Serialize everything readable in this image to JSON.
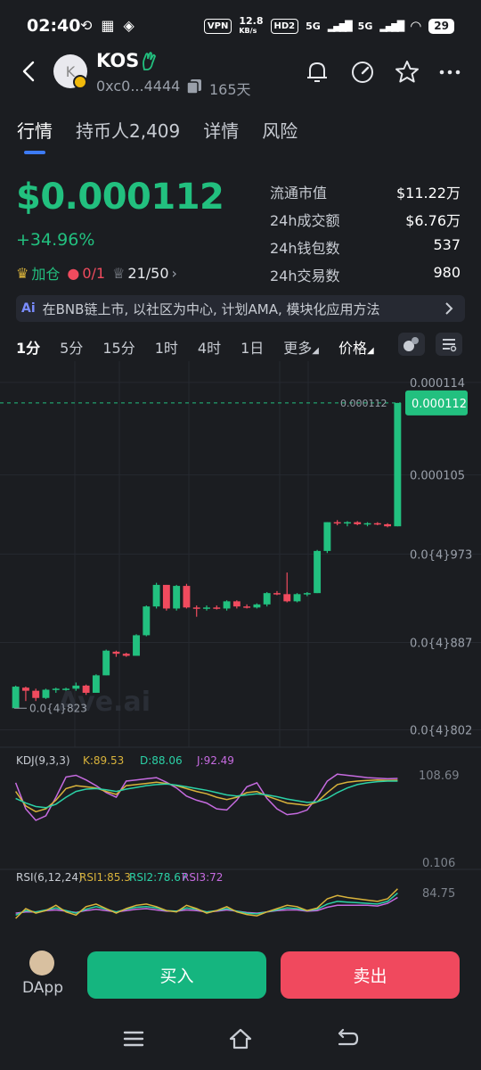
{
  "status": {
    "time": "02:40",
    "vpn": "VPN",
    "net_speed_top": "12.8",
    "net_speed_bottom": "KB/s",
    "hd": "HD2",
    "sig1": "5G",
    "sig2": "5G",
    "battery": "29"
  },
  "header": {
    "token_symbol": "KOS",
    "avatar_letter": "K",
    "address": "0xc0...4444",
    "age": "165天"
  },
  "tabs": [
    {
      "label": "行情"
    },
    {
      "label": "持币人2,409"
    },
    {
      "label": "详情"
    },
    {
      "label": "风险"
    }
  ],
  "price": {
    "value": "$0.000112",
    "change": "+34.96%"
  },
  "chips": {
    "add": "加仓",
    "bag": "0/1",
    "crown": "21/50"
  },
  "stats": [
    {
      "label": "流通市值",
      "value": "$11.22万"
    },
    {
      "label": "24h成交额",
      "value": "$6.76万"
    },
    {
      "label": "24h钱包数",
      "value": "537"
    },
    {
      "label": "24h交易数",
      "value": "980"
    }
  ],
  "ai_banner": {
    "tag": "Ai",
    "text": "在BNB链上市, 以社区为中心, 计划AMA, 模块化应用方法"
  },
  "intervals": {
    "items": [
      "1分",
      "5分",
      "15分",
      "1时",
      "4时",
      "1日"
    ],
    "more": "更多",
    "price": "价格"
  },
  "colors": {
    "up": "#22c07f",
    "down": "#f04b5e",
    "k": "#d9b33b",
    "d": "#2bd1a6",
    "j": "#c66be0",
    "rsi1": "#d9b33b",
    "rsi2": "#2bd1a6",
    "rsi3": "#c66be0"
  },
  "chart_data": {
    "type": "candlestick",
    "ylim": [
      8.02e-05,
      0.000114
    ],
    "y_ticks": [
      "0.000114",
      "0.000105",
      "0.0{4}973",
      "0.0{4}887",
      "0.0{4}802"
    ],
    "y_tick_values": [
      0.000114,
      0.000105,
      9.73e-05,
      8.87e-05,
      8.02e-05
    ],
    "last_price_label": "0.000112",
    "last_price": 0.000112,
    "low_label": "0.0{4}823",
    "low_value": 8.23e-05,
    "watermark": "Ave.ai",
    "candles": [
      {
        "o": 8.23e-05,
        "h": 8.45e-05,
        "l": 8.23e-05,
        "c": 8.44e-05
      },
      {
        "o": 8.43e-05,
        "h": 8.44e-05,
        "l": 8.3e-05,
        "c": 8.4e-05
      },
      {
        "o": 8.4e-05,
        "h": 8.42e-05,
        "l": 8.3e-05,
        "c": 8.33e-05
      },
      {
        "o": 8.33e-05,
        "h": 8.42e-05,
        "l": 8.32e-05,
        "c": 8.41e-05
      },
      {
        "o": 8.41e-05,
        "h": 8.43e-05,
        "l": 8.38e-05,
        "c": 8.42e-05
      },
      {
        "o": 8.42e-05,
        "h": 8.43e-05,
        "l": 8.4e-05,
        "c": 8.42e-05
      },
      {
        "o": 8.42e-05,
        "h": 8.48e-05,
        "l": 8.4e-05,
        "c": 8.45e-05
      },
      {
        "o": 8.45e-05,
        "h": 8.46e-05,
        "l": 8.36e-05,
        "c": 8.38e-05
      },
      {
        "o": 8.38e-05,
        "h": 8.56e-05,
        "l": 8.38e-05,
        "c": 8.55e-05
      },
      {
        "o": 8.55e-05,
        "h": 8.8e-05,
        "l": 8.55e-05,
        "c": 8.79e-05
      },
      {
        "o": 8.78e-05,
        "h": 8.79e-05,
        "l": 8.73e-05,
        "c": 8.76e-05
      },
      {
        "o": 8.76e-05,
        "h": 8.77e-05,
        "l": 8.73e-05,
        "c": 8.74e-05
      },
      {
        "o": 8.74e-05,
        "h": 8.95e-05,
        "l": 8.74e-05,
        "c": 8.94e-05
      },
      {
        "o": 8.94e-05,
        "h": 9.23e-05,
        "l": 8.93e-05,
        "c": 9.22e-05
      },
      {
        "o": 9.22e-05,
        "h": 9.45e-05,
        "l": 9.2e-05,
        "c": 9.43e-05
      },
      {
        "o": 9.43e-05,
        "h": 9.42e-05,
        "l": 9.18e-05,
        "c": 9.2e-05
      },
      {
        "o": 9.2e-05,
        "h": 9.43e-05,
        "l": 9.18e-05,
        "c": 9.42e-05
      },
      {
        "o": 9.42e-05,
        "h": 9.44e-05,
        "l": 9.2e-05,
        "c": 9.21e-05
      },
      {
        "o": 9.21e-05,
        "h": 9.23e-05,
        "l": 9.12e-05,
        "c": 9.2e-05
      },
      {
        "o": 9.2e-05,
        "h": 9.23e-05,
        "l": 9.18e-05,
        "c": 9.21e-05
      },
      {
        "o": 9.21e-05,
        "h": 9.23e-05,
        "l": 9.19e-05,
        "c": 9.2e-05
      },
      {
        "o": 9.2e-05,
        "h": 9.28e-05,
        "l": 9.18e-05,
        "c": 9.27e-05
      },
      {
        "o": 9.27e-05,
        "h": 9.28e-05,
        "l": 9.2e-05,
        "c": 9.22e-05
      },
      {
        "o": 9.22e-05,
        "h": 9.24e-05,
        "l": 9.2e-05,
        "c": 9.21e-05
      },
      {
        "o": 9.21e-05,
        "h": 9.25e-05,
        "l": 9.2e-05,
        "c": 9.24e-05
      },
      {
        "o": 9.24e-05,
        "h": 9.36e-05,
        "l": 9.22e-05,
        "c": 9.35e-05
      },
      {
        "o": 9.35e-05,
        "h": 9.37e-05,
        "l": 9.33e-05,
        "c": 9.34e-05
      },
      {
        "o": 9.34e-05,
        "h": 9.55e-05,
        "l": 9.26e-05,
        "c": 9.27e-05
      },
      {
        "o": 9.27e-05,
        "h": 9.35e-05,
        "l": 9.26e-05,
        "c": 9.34e-05
      },
      {
        "o": 9.34e-05,
        "h": 9.36e-05,
        "l": 9.32e-05,
        "c": 9.35e-05
      },
      {
        "o": 9.35e-05,
        "h": 9.77e-05,
        "l": 9.35e-05,
        "c": 9.76e-05
      },
      {
        "o": 9.76e-05,
        "h": 9.8e-05,
        "l": 9.74e-05,
        "c": 0.0001004
      },
      {
        "o": 0.0001004,
        "h": 0.0001006,
        "l": 0.0001001,
        "c": 0.0001003
      },
      {
        "o": 0.0001003,
        "h": 0.0001005,
        "l": 0.0001,
        "c": 0.0001004
      },
      {
        "o": 0.0001004,
        "h": 0.0001005,
        "l": 0.0001001,
        "c": 0.0001002
      },
      {
        "o": 0.0001002,
        "h": 0.0001004,
        "l": 0.0001,
        "c": 0.0001003
      },
      {
        "o": 0.0001003,
        "h": 0.0001004,
        "l": 0.0001001,
        "c": 0.0001002
      },
      {
        "o": 0.0001002,
        "h": 0.0001003,
        "l": 9.99e-05,
        "c": 0.0001
      },
      {
        "o": 0.0001,
        "h": 0.000112,
        "l": 0.0001,
        "c": 0.000112
      }
    ]
  },
  "kdj": {
    "label": "KDJ(9,3,3)",
    "k_label": "K:89.53",
    "d_label": "D:88.06",
    "j_label": "J:92.49",
    "top": "108.69",
    "bottom": "0.106",
    "k": [
      70,
      45,
      35,
      40,
      55,
      75,
      80,
      78,
      76,
      70,
      65,
      80,
      82,
      84,
      86,
      84,
      80,
      75,
      70,
      66,
      60,
      56,
      60,
      68,
      70,
      62,
      56,
      50,
      48,
      46,
      52,
      68,
      82,
      86,
      88,
      89,
      90,
      89,
      89.5
    ],
    "d": [
      58,
      50,
      44,
      42,
      48,
      60,
      70,
      74,
      75,
      73,
      70,
      74,
      77,
      80,
      82,
      83,
      81,
      78,
      75,
      72,
      68,
      64,
      62,
      64,
      66,
      64,
      61,
      57,
      54,
      51,
      52,
      58,
      68,
      76,
      82,
      85,
      87,
      88,
      88
    ],
    "j": [
      85,
      40,
      20,
      28,
      60,
      95,
      98,
      90,
      80,
      68,
      60,
      88,
      90,
      92,
      94,
      86,
      76,
      62,
      55,
      50,
      40,
      38,
      55,
      78,
      85,
      58,
      40,
      30,
      32,
      38,
      60,
      88,
      100,
      98,
      96,
      94,
      93,
      92,
      92.5
    ]
  },
  "rsi": {
    "label": "RSI(6,12,24)",
    "rsi1_label": "RSI1:85.3",
    "rsi2_label": "RSI2:78.67",
    "rsi3_label": "RSI3:72",
    "top": "84.75",
    "r1": [
      40,
      55,
      48,
      52,
      60,
      50,
      45,
      58,
      62,
      55,
      48,
      55,
      60,
      62,
      58,
      52,
      50,
      60,
      55,
      48,
      52,
      58,
      50,
      46,
      44,
      50,
      55,
      60,
      58,
      52,
      56,
      70,
      75,
      72,
      70,
      68,
      66,
      70,
      85.3
    ],
    "r2": [
      45,
      52,
      50,
      53,
      56,
      52,
      48,
      54,
      58,
      54,
      50,
      54,
      57,
      58,
      56,
      52,
      51,
      56,
      54,
      50,
      52,
      55,
      51,
      48,
      47,
      50,
      53,
      56,
      55,
      52,
      54,
      62,
      66,
      65,
      64,
      63,
      62,
      66,
      78.67
    ],
    "r3": [
      48,
      50,
      50,
      52,
      53,
      51,
      49,
      52,
      54,
      52,
      50,
      52,
      54,
      55,
      53,
      51,
      51,
      53,
      52,
      50,
      51,
      53,
      51,
      49,
      48,
      50,
      52,
      53,
      53,
      51,
      52,
      57,
      60,
      60,
      60,
      60,
      59,
      63,
      72
    ]
  },
  "bottom": {
    "dapp": "DApp",
    "buy": "买入",
    "sell": "卖出"
  }
}
